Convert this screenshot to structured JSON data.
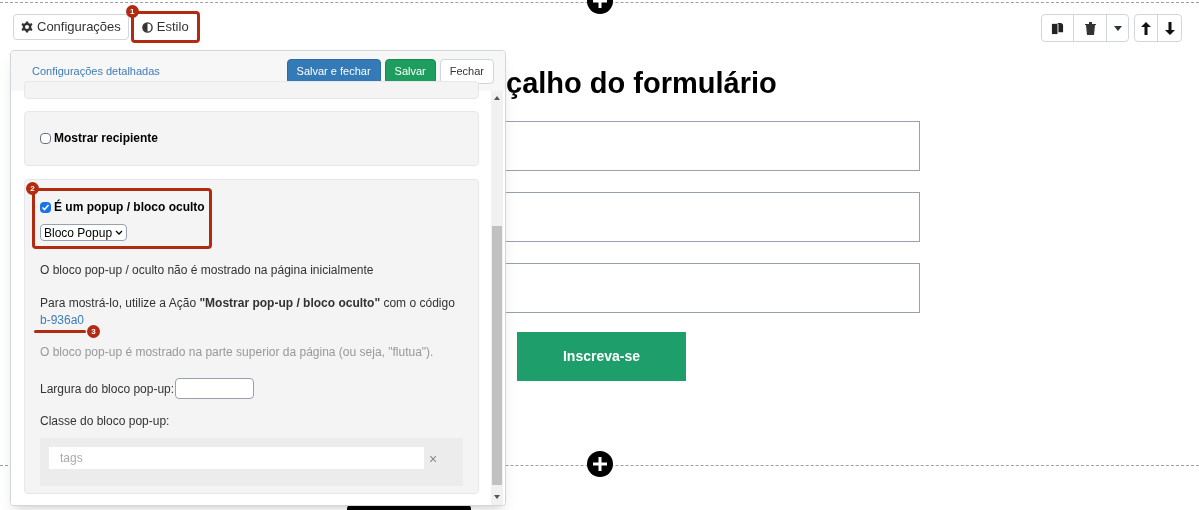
{
  "tabs": [
    {
      "label": "Configurações",
      "selected": false
    },
    {
      "label": "Estilo",
      "selected": true
    }
  ],
  "popover": {
    "header_link": "Configurações detalhadas",
    "buttons": [
      {
        "label": "Salvar e fechar",
        "kind": "primary"
      },
      {
        "label": "Salvar",
        "kind": "success"
      },
      {
        "label": "Fechar",
        "kind": "default"
      }
    ],
    "show_container": {
      "label": "Mostrar recipiente",
      "checked": false
    },
    "popup": {
      "label": "É um popup / bloco oculto",
      "checked": true,
      "select_value": "Bloco Popup",
      "info": "O bloco pop-up / oculto não é mostrado na página inicialmente",
      "instruction": "Para mostrá-lo, utilize a Ação **\"Mostrar pop-up / bloco oculto\"** com o código",
      "code_link": "b-936a0",
      "note": "O bloco pop-up é mostrado na parte superior da página (ou seja, \"flutua\").",
      "width_label": "Largura do bloco pop-up:",
      "class_label": "Classe do bloco pop-up:",
      "tags_placeholder": "tags",
      "clear": "×"
    }
  },
  "annotations": [
    {
      "number": "1"
    },
    {
      "number": "2"
    },
    {
      "number": "3"
    }
  ],
  "form": {
    "heading": "çalho do formulário",
    "fields": [
      {
        "kind": "text"
      },
      {
        "kind": "text"
      },
      {
        "kind": "text"
      }
    ],
    "submit": "Inscreva-se"
  }
}
